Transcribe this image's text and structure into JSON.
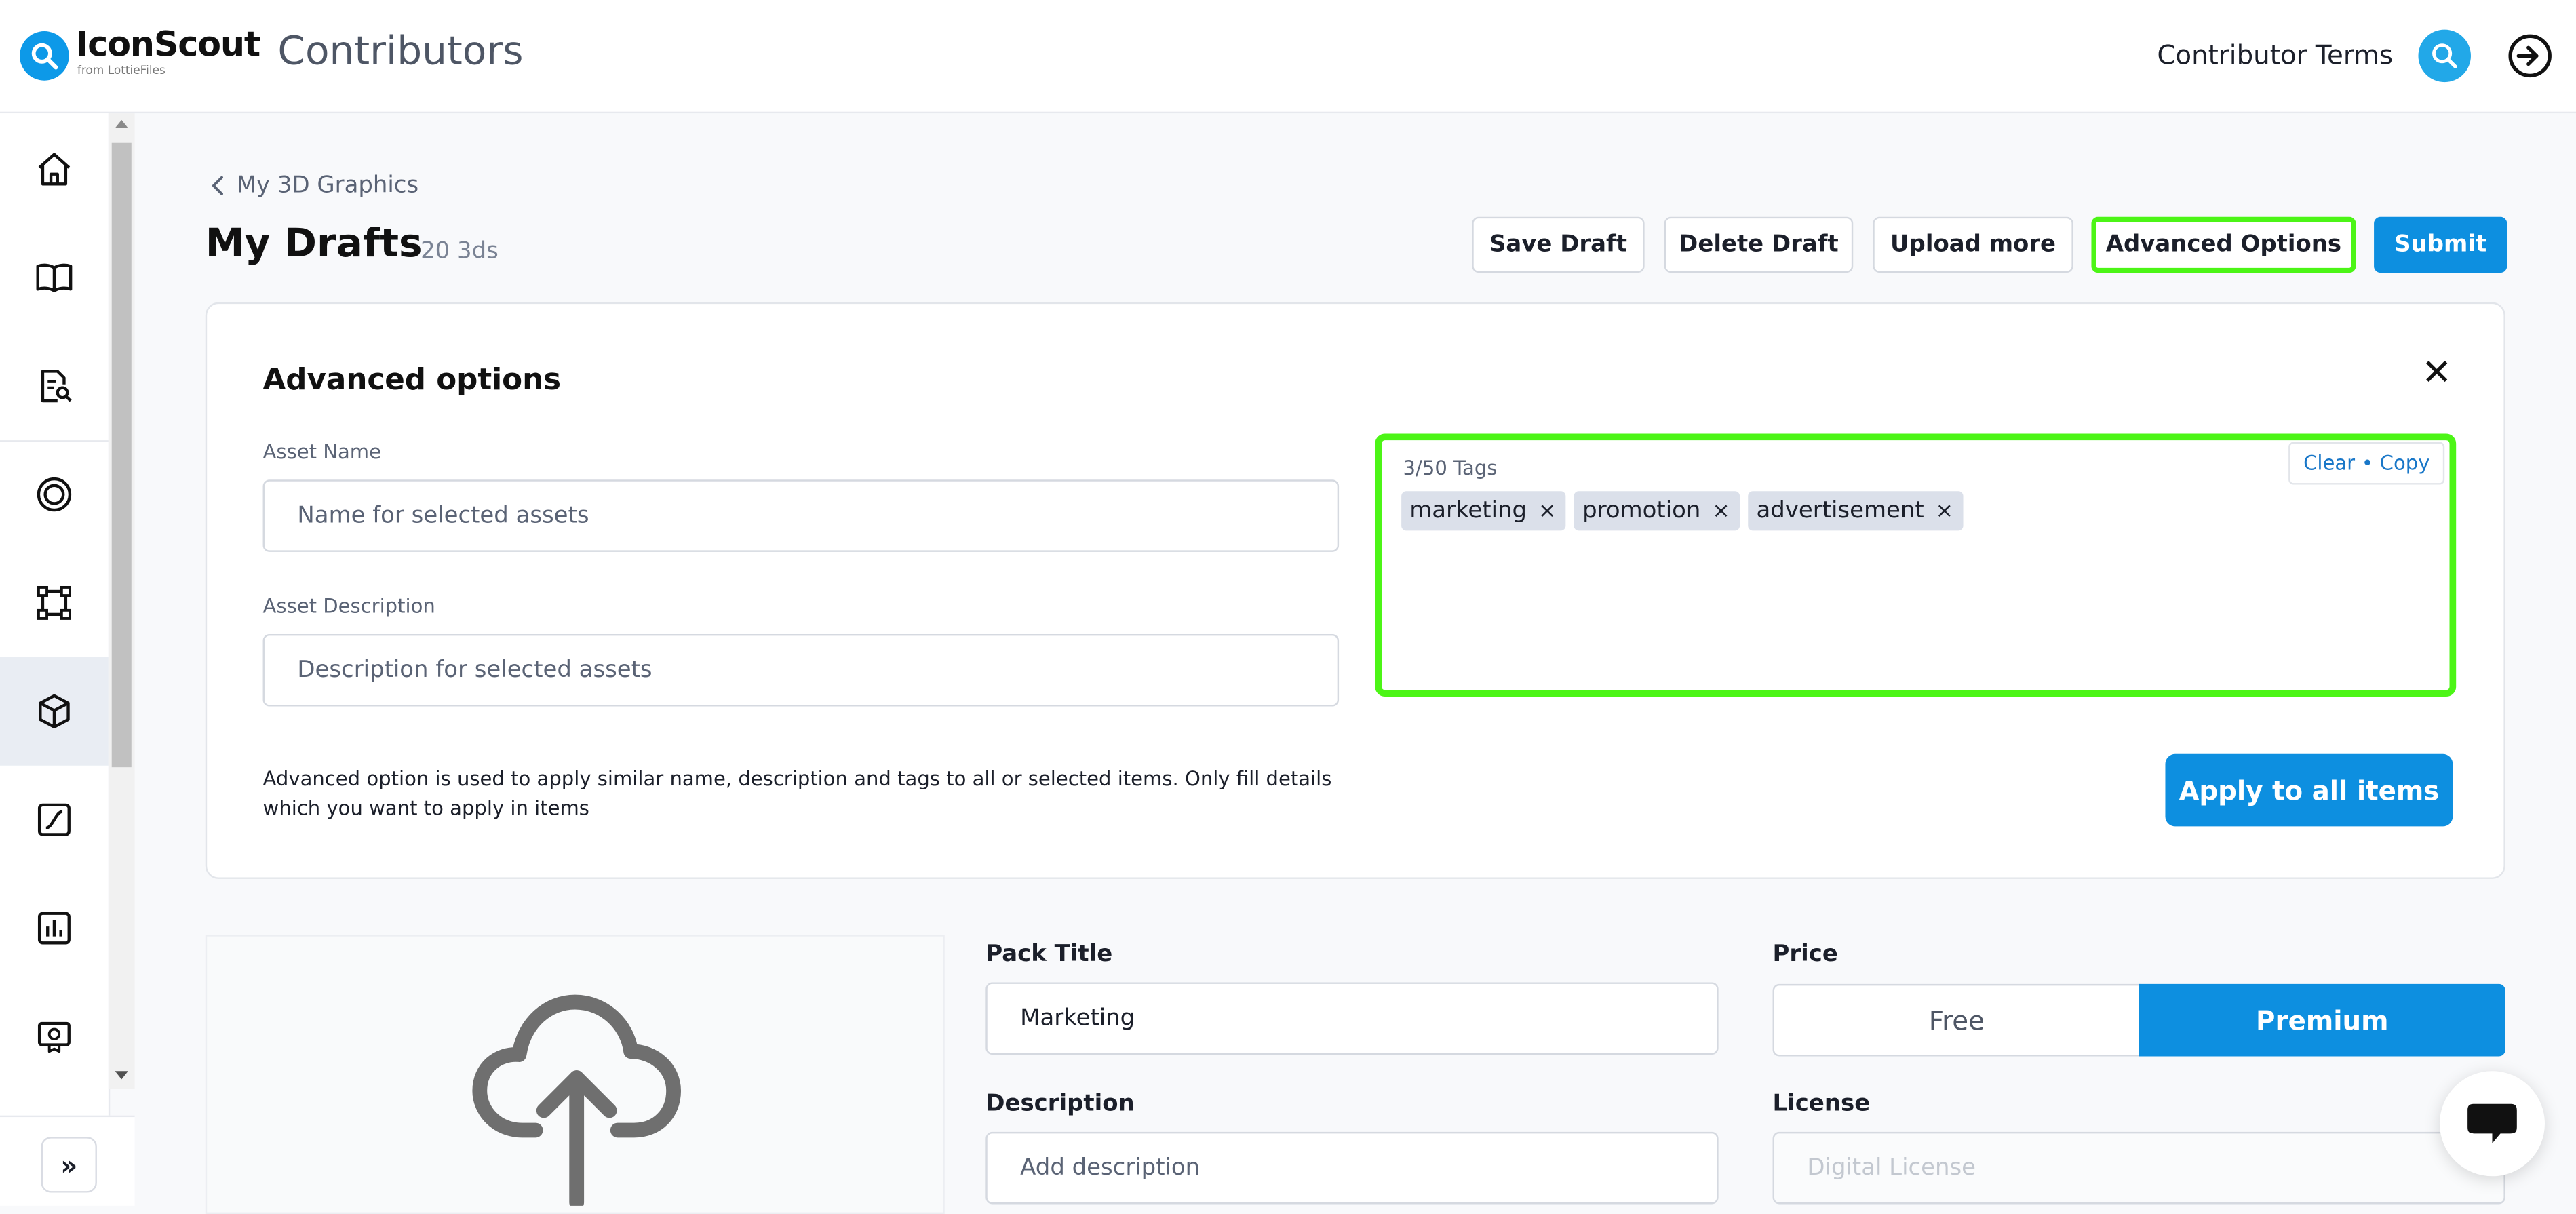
{
  "header": {
    "logo_text": "IconScout",
    "logo_sub": "from LottieFiles",
    "app_title": "Contributors",
    "terms_link": "Contributor Terms"
  },
  "sidebar": {
    "items": [
      {
        "icon": "home-icon"
      },
      {
        "icon": "book-icon"
      },
      {
        "icon": "document-search-icon"
      },
      {
        "icon": "target-icon"
      },
      {
        "icon": "vector-icon"
      },
      {
        "icon": "cube-icon",
        "active": true
      },
      {
        "icon": "curve-icon"
      },
      {
        "icon": "bar-chart-icon"
      },
      {
        "icon": "badge-icon"
      }
    ],
    "expand_label": "»"
  },
  "page": {
    "breadcrumb": "My 3D Graphics",
    "title": "My Drafts",
    "count": "20 3ds",
    "buttons": {
      "save": "Save Draft",
      "delete": "Delete Draft",
      "upload": "Upload more",
      "advanced": "Advanced Options",
      "submit": "Submit"
    }
  },
  "advanced": {
    "title": "Advanced options",
    "asset_name_label": "Asset Name",
    "asset_name_placeholder": "Name for selected assets",
    "asset_desc_label": "Asset Description",
    "asset_desc_placeholder": "Description for selected assets",
    "tags_count": "3/50 Tags",
    "clear": "Clear",
    "separator": "•",
    "copy": "Copy",
    "tags": [
      "marketing",
      "promotion",
      "advertisement"
    ],
    "tag_remove": "×",
    "helper": "Advanced option is used to apply similar name, description and tags to all or selected items. Only fill details which you want to apply in items",
    "apply": "Apply to all items"
  },
  "item_form": {
    "pack_title_label": "Pack Title",
    "pack_title_value": "Marketing",
    "description_label": "Description",
    "description_placeholder": "Add description",
    "price_label": "Price",
    "price_free": "Free",
    "price_premium": "Premium",
    "license_label": "License",
    "license_placeholder": "Digital License"
  },
  "colors": {
    "primary": "#0d8fe0",
    "highlight": "#4cf516"
  }
}
